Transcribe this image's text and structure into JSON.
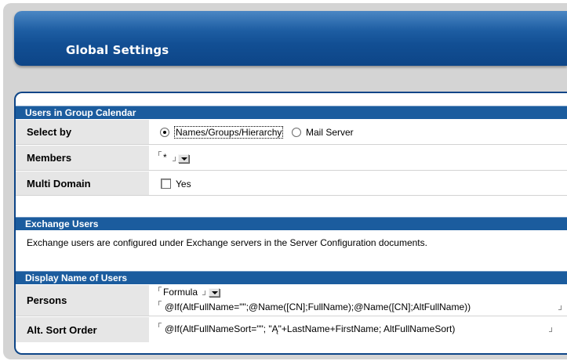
{
  "header": {
    "title": "Global Settings"
  },
  "sections": {
    "users_group_calendar": {
      "title": "Users in Group Calendar",
      "select_by": {
        "label": "Select by",
        "options": [
          "Names/Groups/Hierarchy",
          "Mail Server"
        ],
        "selected": "Names/Groups/Hierarchy"
      },
      "members": {
        "label": "Members",
        "value": "*"
      },
      "multi_domain": {
        "label": "Multi Domain",
        "checkbox_label": "Yes",
        "checked": false
      }
    },
    "exchange_users": {
      "title": "Exchange Users",
      "description": "Exchange users are configured under Exchange servers in the Server Configuration documents."
    },
    "display_name": {
      "title": "Display Name of Users",
      "persons": {
        "label": "Persons",
        "type_value": "Formula",
        "formula": "@If(AltFullName=\"\";@Name([CN];FullName);@Name([CN];AltFullName))"
      },
      "alt_sort": {
        "label": "Alt. Sort Order",
        "formula": "@If(AltFullNameSort=\"\"; \"Ą\"+LastName+FirstName; AltFullNameSort)"
      }
    }
  }
}
